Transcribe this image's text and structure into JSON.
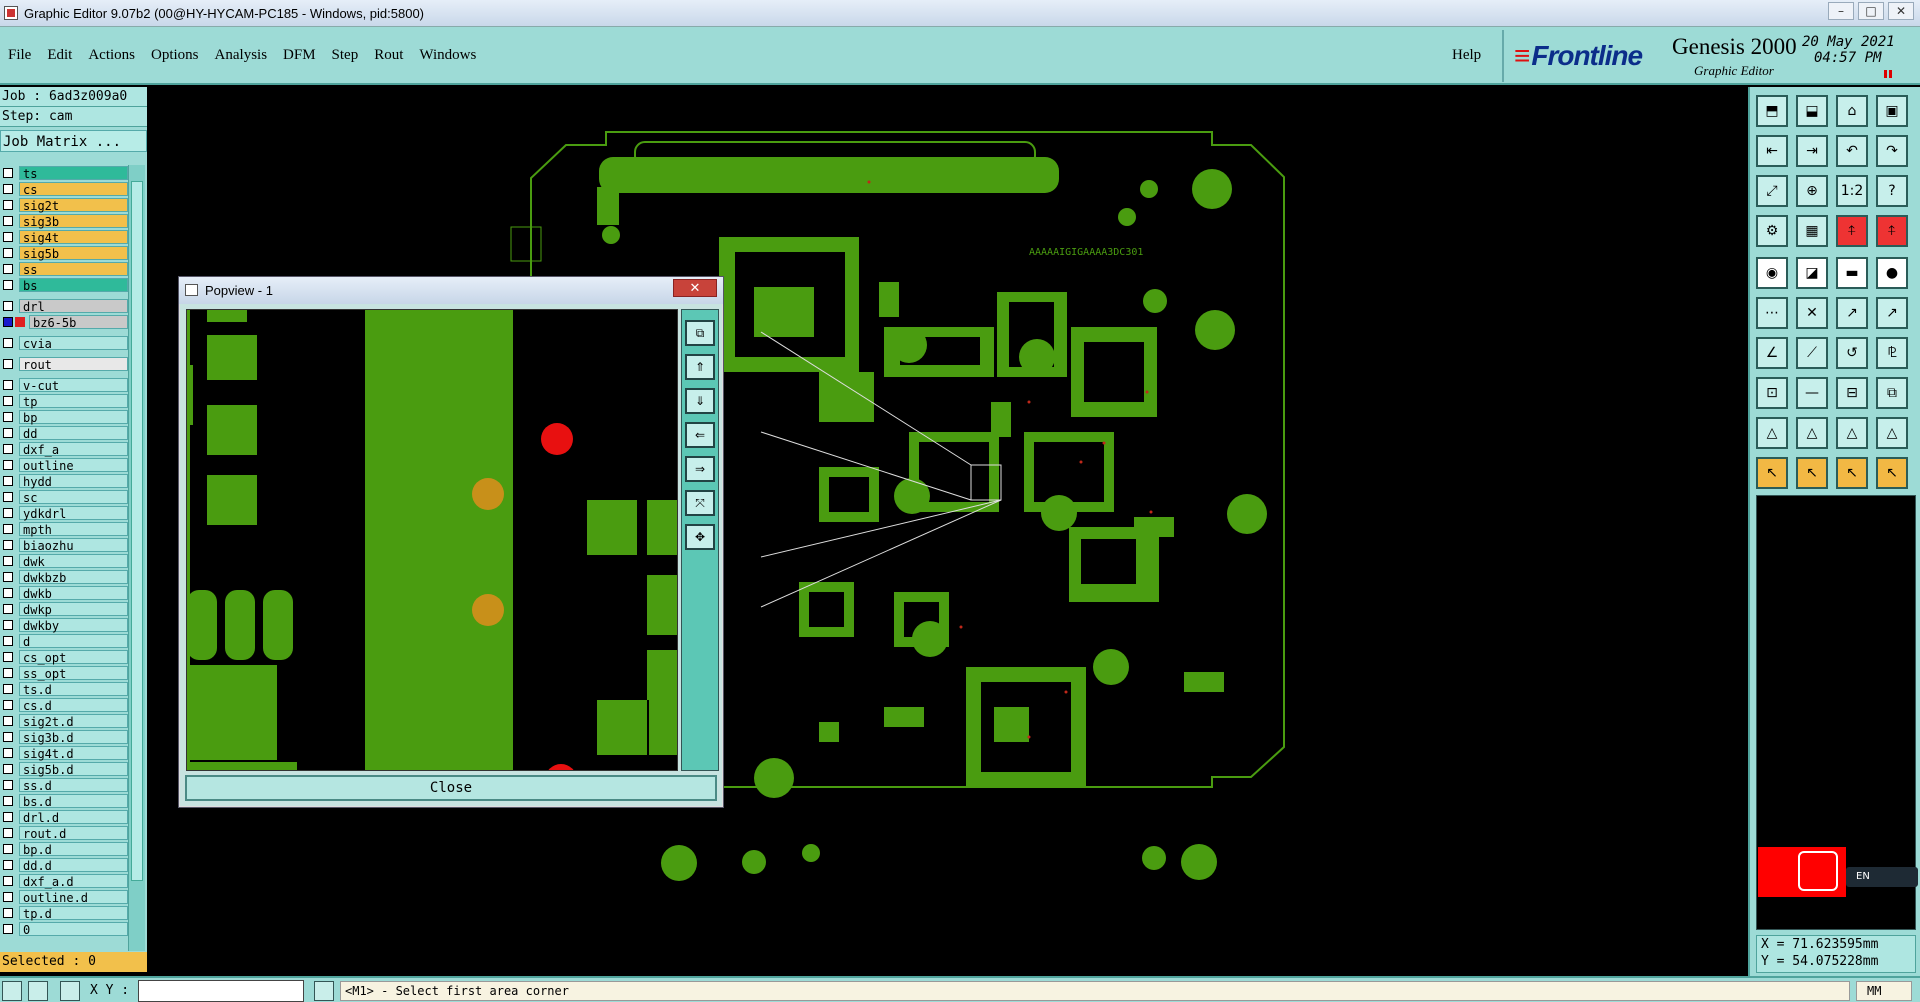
{
  "window": {
    "title": "Graphic Editor 9.07b2 (00@HY-HYCAM-PC185 - Windows, pid:5800)",
    "min": "–",
    "max": "□",
    "close": "✕"
  },
  "menu": {
    "items": [
      {
        "label": "File",
        "key": "F"
      },
      {
        "label": "Edit",
        "key": "E"
      },
      {
        "label": "Actions",
        "key": "A"
      },
      {
        "label": "Options",
        "key": "O"
      },
      {
        "label": "Analysis",
        "key": "A"
      },
      {
        "label": "DFM",
        "key": "D"
      },
      {
        "label": "Step",
        "key": "S"
      },
      {
        "label": "Rout",
        "key": "R"
      },
      {
        "label": "Windows",
        "key": "W"
      }
    ],
    "help": "Help"
  },
  "brand": {
    "logo": "Frontline",
    "product": "Genesis 2000",
    "subtitle": "Graphic Editor",
    "date": "20 May 2021",
    "time": "04:57 PM"
  },
  "job": {
    "job_line": "Job : 6ad3z009a0",
    "step_line": "Step: cam",
    "matrix_button": "Job Matrix ..."
  },
  "layers": [
    {
      "name": "ts",
      "style": "green",
      "swatch": ""
    },
    {
      "name": "cs",
      "style": "orange",
      "swatch": ""
    },
    {
      "name": "sig2t",
      "style": "orange",
      "swatch": ""
    },
    {
      "name": "sig3b",
      "style": "orange",
      "swatch": ""
    },
    {
      "name": "sig4t",
      "style": "orange",
      "swatch": ""
    },
    {
      "name": "sig5b",
      "style": "orange",
      "swatch": ""
    },
    {
      "name": "ss",
      "style": "orange",
      "swatch": ""
    },
    {
      "name": "bs",
      "style": "green",
      "swatch": "",
      "gap_after": true
    },
    {
      "name": "drl",
      "style": "grey",
      "swatch": ""
    },
    {
      "name": "bz6-5b",
      "style": "grey",
      "swatch": "#e02020",
      "selected": true,
      "gap_after": true
    },
    {
      "name": "cvia",
      "style": "normal",
      "swatch": "",
      "gap_after": true
    },
    {
      "name": "rout",
      "style": "white",
      "swatch": "",
      "gap_after": true
    },
    {
      "name": "v-cut",
      "style": "normal",
      "swatch": ""
    },
    {
      "name": "tp",
      "style": "normal",
      "swatch": ""
    },
    {
      "name": "bp",
      "style": "normal",
      "swatch": ""
    },
    {
      "name": "dd",
      "style": "normal",
      "swatch": ""
    },
    {
      "name": "dxf_a",
      "style": "normal",
      "swatch": ""
    },
    {
      "name": "outline",
      "style": "normal",
      "swatch": ""
    },
    {
      "name": "hydd",
      "style": "normal",
      "swatch": ""
    },
    {
      "name": "sc",
      "style": "normal",
      "swatch": ""
    },
    {
      "name": "ydkdrl",
      "style": "normal",
      "swatch": ""
    },
    {
      "name": "mpth",
      "style": "normal",
      "swatch": ""
    },
    {
      "name": "biaozhu",
      "style": "normal",
      "swatch": ""
    },
    {
      "name": "dwk",
      "style": "normal",
      "swatch": ""
    },
    {
      "name": "dwkbzb",
      "style": "normal",
      "swatch": ""
    },
    {
      "name": "dwkb",
      "style": "normal",
      "swatch": ""
    },
    {
      "name": "dwkp",
      "style": "normal",
      "swatch": ""
    },
    {
      "name": "dwkby",
      "style": "normal",
      "swatch": ""
    },
    {
      "name": "d",
      "style": "normal",
      "swatch": ""
    },
    {
      "name": "cs_opt",
      "style": "normal",
      "swatch": ""
    },
    {
      "name": "ss_opt",
      "style": "normal",
      "swatch": ""
    },
    {
      "name": "ts.d",
      "style": "normal",
      "swatch": ""
    },
    {
      "name": "cs.d",
      "style": "normal",
      "swatch": ""
    },
    {
      "name": "sig2t.d",
      "style": "normal",
      "swatch": ""
    },
    {
      "name": "sig3b.d",
      "style": "normal",
      "swatch": ""
    },
    {
      "name": "sig4t.d",
      "style": "normal",
      "swatch": ""
    },
    {
      "name": "sig5b.d",
      "style": "normal",
      "swatch": ""
    },
    {
      "name": "ss.d",
      "style": "normal",
      "swatch": ""
    },
    {
      "name": "bs.d",
      "style": "normal",
      "swatch": ""
    },
    {
      "name": "drl.d",
      "style": "normal",
      "swatch": ""
    },
    {
      "name": "rout.d",
      "style": "normal",
      "swatch": ""
    },
    {
      "name": "bp.d",
      "style": "normal",
      "swatch": ""
    },
    {
      "name": "dd.d",
      "style": "normal",
      "swatch": ""
    },
    {
      "name": "dxf_a.d",
      "style": "normal",
      "swatch": ""
    },
    {
      "name": "outline.d",
      "style": "normal",
      "swatch": ""
    },
    {
      "name": "tp.d",
      "style": "normal",
      "swatch": ""
    },
    {
      "name": "0",
      "style": "normal",
      "swatch": ""
    }
  ],
  "selected": "Selected : 0",
  "status": {
    "xy_label": "X Y :",
    "xy_value": "",
    "message": "<M1> - Select first area corner",
    "units": "MM"
  },
  "coords": {
    "x": "X = 71.623595mm",
    "y": "Y = 54.075228mm"
  },
  "ime": "EN",
  "board_text": "AAAAAIGIGAAAA3DC301",
  "popview": {
    "title": "Popview - 1",
    "close_x": "✕",
    "close_button": "Close"
  },
  "colors": {
    "board": "#4a9c10",
    "panel": "#9ddbd6",
    "accent": "#f2c04b",
    "highlight": "#e33"
  },
  "toolbar_icons": [
    "zoom-home-icon",
    "open-icon",
    "home-icon",
    "frame-icon",
    "pan-left-icon",
    "pan-right-icon",
    "undo-view-icon",
    "redo-view-icon",
    "fit-icon",
    "zoom-area-icon",
    "scale-1-2-icon",
    "help-icon",
    "tools-icon",
    "grid-icon",
    "measure-icon",
    "measure2-icon",
    "pad-icon",
    "line-icon",
    "film-icon",
    "circle-icon",
    "snap-icon",
    "cross-icon",
    "point-icon",
    "connect-icon",
    "angle-icon",
    "slope-icon",
    "arc-icon",
    "text-icon",
    "select-icon",
    "dash-icon",
    "frame2-icon",
    "copy-icon",
    "triangle-icon",
    "triangle2-icon",
    "triangle3-icon",
    "triangle4-icon",
    "pointer-icon",
    "pointer2-icon",
    "pointer3-icon",
    "pointer4-icon"
  ]
}
